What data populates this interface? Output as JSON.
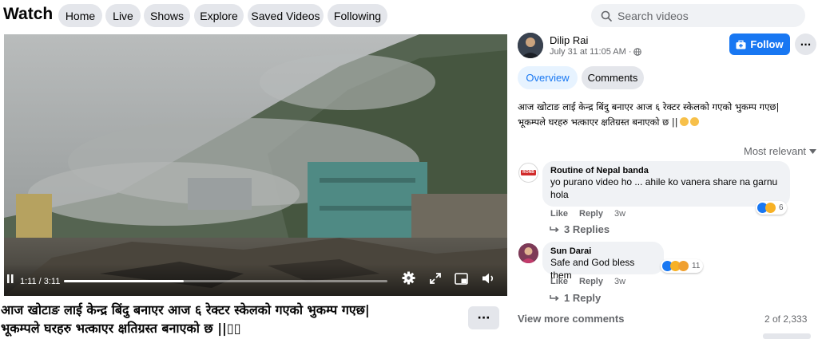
{
  "topbar": {
    "title": "Watch",
    "nav": [
      "Home",
      "Live",
      "Shows",
      "Explore",
      "Saved Videos",
      "Following"
    ],
    "search_placeholder": "Search videos"
  },
  "video": {
    "timecode": "1:11 / 3:11",
    "progress": 0.37,
    "caption_line1": "आज खोटाङ लाई केन्द्र बिंदु बनाएर आज ६ रेक्टर स्केलको गएको भुकम्प गएछ|",
    "caption_line2": "भूकम्पले घरहरु भत्काएर क्षतिग्रस्त बनाएको छ ||▯▯",
    "more_label": "···"
  },
  "post": {
    "author": "Dilip Rai",
    "date": "July 31 at 11:05 AM",
    "follow_label": "Follow",
    "options_label": "···",
    "tabs": [
      "Overview",
      "Comments"
    ],
    "text_line1": "आज खोटाङ लाई केन्द्र बिंदु बनाएर आज ६ रेक्टर स्केलको गएको भुकम्प गएछ|",
    "text_line2": "भूकम्पले घरहरु भत्काएर क्षतिग्रस्त बनाएको छ ||",
    "sort_label": "Most relevant"
  },
  "comments": [
    {
      "author": "Routine of Nepal banda",
      "avatar_text": "RONB",
      "text_line1": "yo purano video ho ... ahile ko vanera share na garnu",
      "text_line2": "hola",
      "like": "Like",
      "reply": "Reply",
      "age": "3w",
      "reaction_count": "6",
      "replies": "3 Replies"
    },
    {
      "author": "Sun Darai",
      "text": "Safe and God bless them",
      "like": "Like",
      "reply": "Reply",
      "age": "3w",
      "reaction_count": "11",
      "replies": "1 Reply"
    }
  ],
  "footer": {
    "view_more": "View more comments",
    "count": "2 of 2,333"
  },
  "colors": {
    "accent": "#1877f2",
    "pill_bg": "#e4e6eb",
    "secondary_text": "#65676b"
  }
}
